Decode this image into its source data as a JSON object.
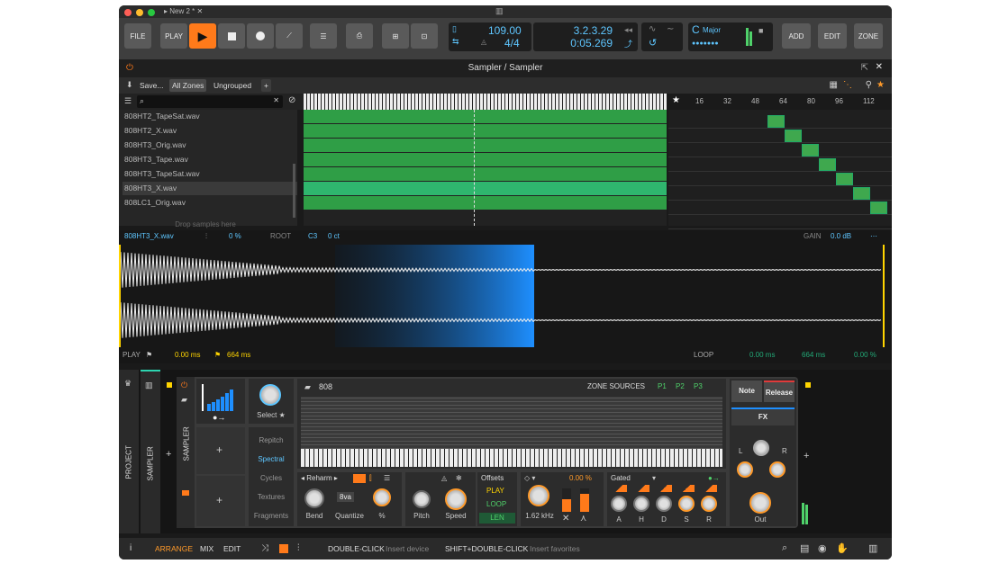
{
  "window": {
    "title": "New 2 *"
  },
  "toolbar": {
    "file": "FILE",
    "play_label": "PLAY",
    "add": "ADD",
    "edit": "EDIT",
    "zone": "ZONE",
    "tempo": "109.00",
    "time_sig": "4/4",
    "position": "3.2.3.29",
    "time": "0:05.269",
    "key": "C",
    "scale": "Major"
  },
  "panel": {
    "title": "Sampler / Sampler"
  },
  "subbar": {
    "save": "Save...",
    "all_zones": "All Zones",
    "ungrouped": "Ungrouped",
    "add": "+"
  },
  "search": {
    "placeholder": ""
  },
  "samples": [
    "808HT2_TapeSat.wav",
    "808HT2_X.wav",
    "808HT3_Orig.wav",
    "808HT3_Tape.wav",
    "808HT3_TapeSat.wav",
    "808HT3_X.wav",
    "808LC1_Orig.wav"
  ],
  "drop_hint": "Drop samples here",
  "velocity_ruler": [
    "16",
    "32",
    "48",
    "64",
    "80",
    "96",
    "112"
  ],
  "wave": {
    "file": "808HT3_X.wav",
    "offset": "0 %",
    "root_label": "ROOT",
    "root": "C3",
    "cents": "0 ct",
    "gain_label": "GAIN",
    "gain": "0.0 dB",
    "play": "PLAY",
    "start": "0.00 ms",
    "end": "664 ms",
    "loop": "LOOP",
    "loop_start": "0.00 ms",
    "loop_end": "664 ms",
    "loop_fade": "0.00 %"
  },
  "device": {
    "tabs": [
      "PROJECT",
      "SAMPLER",
      "SAMPLER"
    ],
    "select": "Select",
    "modes": [
      "Repitch",
      "Spectral",
      "Cycles",
      "Textures",
      "Fragments"
    ],
    "folder": "808",
    "zone_sources": "ZONE SOURCES",
    "sources": [
      "P1",
      "P2",
      "P3"
    ],
    "note": "Note",
    "release": "Release",
    "fx": "FX",
    "reharm": "Reharm",
    "bend": "Bend",
    "quantize": "Quantize",
    "quantize_val": "8va",
    "pct": "%",
    "pitch": "Pitch",
    "speed": "Speed",
    "offsets": "Offsets",
    "play": "PLAY",
    "loop": "LOOP",
    "len": "LEN",
    "freq": "1.62 kHz",
    "offset_pct": "0.00 %",
    "env": "Gated",
    "adsr": [
      "A",
      "H",
      "D",
      "S",
      "R"
    ],
    "lr": [
      "L",
      "R"
    ],
    "out": "Out"
  },
  "footer": {
    "arrange": "ARRANGE",
    "mix": "MIX",
    "edit": "EDIT",
    "dbl": "DOUBLE-CLICK",
    "dbl_hint": "Insert device",
    "shift": "SHIFT+DOUBLE-CLICK",
    "shift_hint": "Insert favorites"
  }
}
